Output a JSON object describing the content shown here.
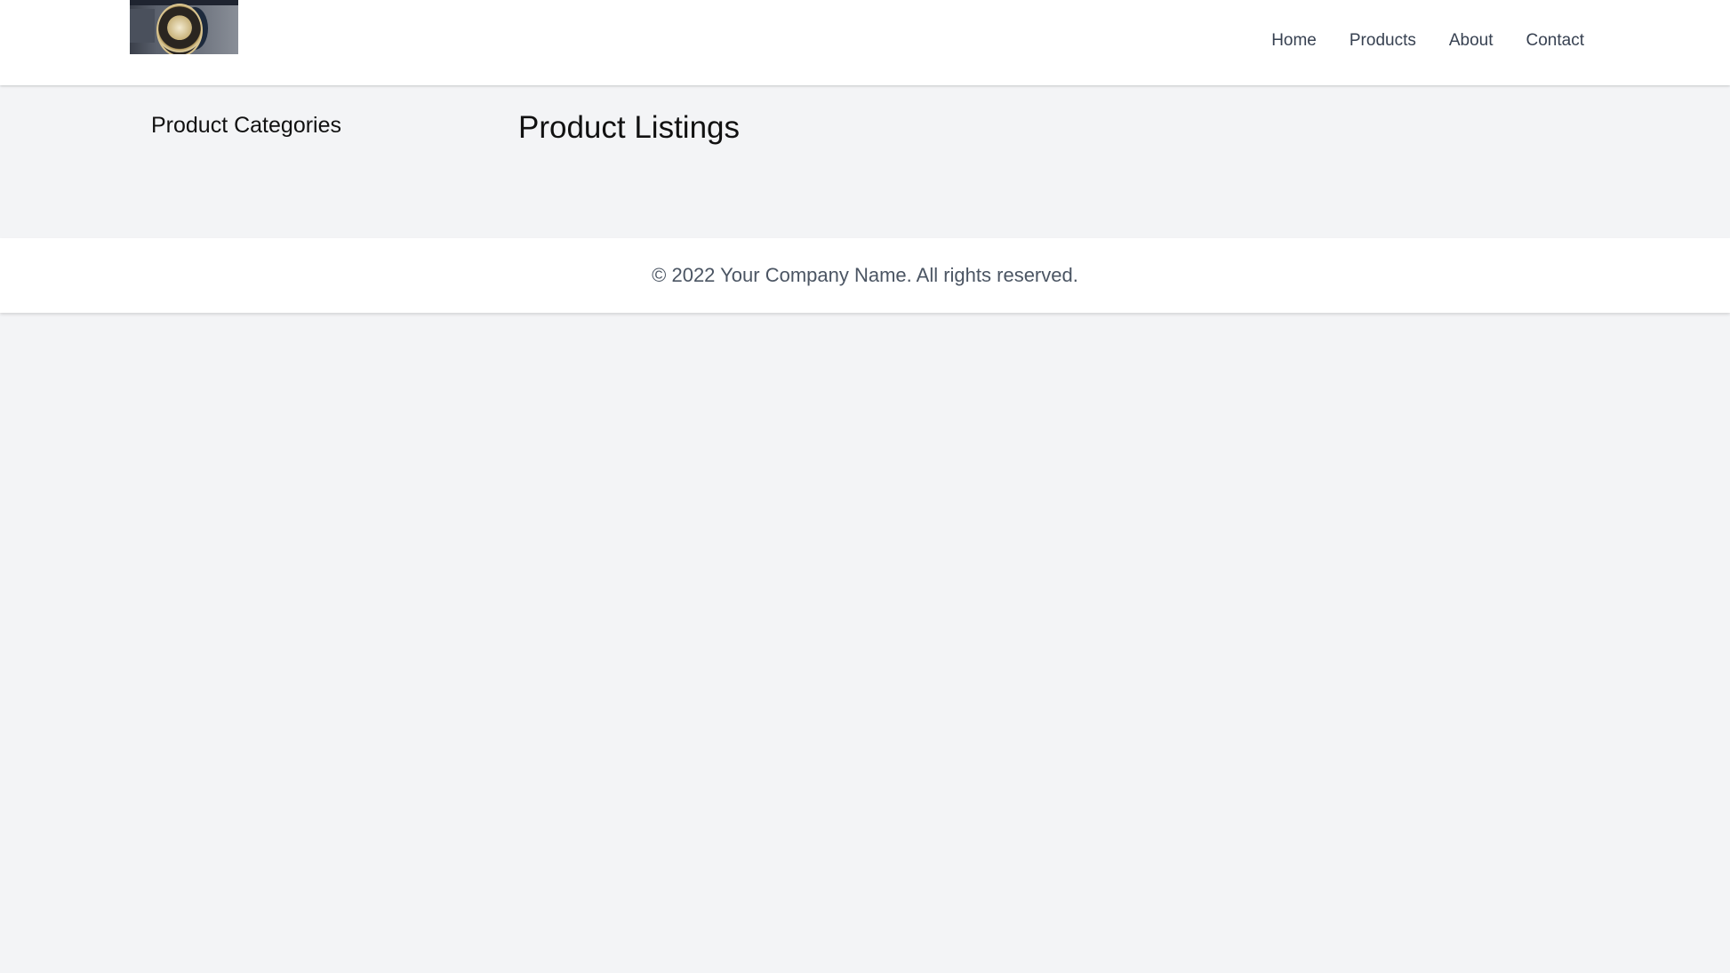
{
  "header": {
    "logo_alt": "Company logo",
    "nav": [
      {
        "label": "Home"
      },
      {
        "label": "Products"
      },
      {
        "label": "About"
      },
      {
        "label": "Contact"
      }
    ]
  },
  "sidebar": {
    "title": "Product Categories"
  },
  "main": {
    "title": "Product Listings"
  },
  "footer": {
    "copyright": "© 2022 Your Company Name. All rights reserved."
  },
  "colors": {
    "page_background": "#f3f4f6",
    "header_background": "#ffffff",
    "nav_text": "#374151",
    "footer_text": "#4b5563"
  }
}
